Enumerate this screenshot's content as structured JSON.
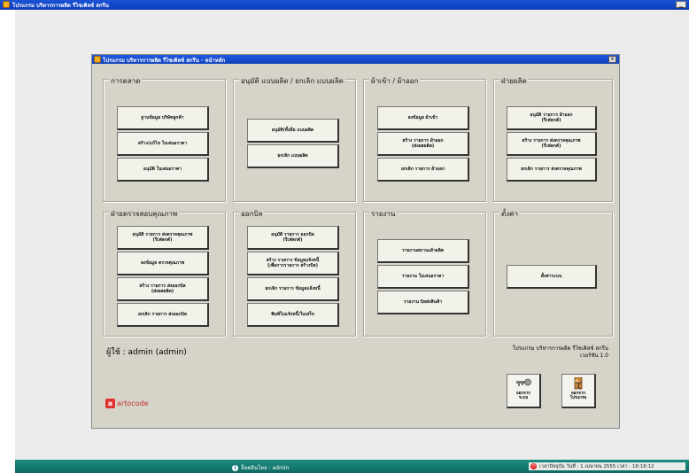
{
  "outer_window": {
    "title": "โปรแกรม บริหารการผลิต รีไซเคิลซ์ สกรีน",
    "control": "_ □"
  },
  "window": {
    "title": "โปรแกรม บริหารการผลิต รีไซเคิลซ์ สกรีน - หน้าหลัก",
    "close": "x"
  },
  "groups": {
    "marketing": {
      "title": "การตลาด",
      "buttons": [
        "ฐานข้อมูล บริษัทลูกค้า",
        "สร้าง/แก้ไข ใบเสนอราคา",
        "อนุมัติ ใบเสนอราคา"
      ]
    },
    "design": {
      "title": "อนุมัติ แบบผลิต / ยกเลิก แบบผลิต",
      "buttons": [
        "อนุมัติ/ทั้งมือ แบบผลิต",
        "ยกเลิก แบบผลิต"
      ]
    },
    "fabric": {
      "title": "ผ้าเข้า / ผ้าออก",
      "buttons": [
        "ลงข้อมูล ผ้าเข้า",
        "สร้าง รายการ ผ้าออก\n(ส่งผลผลิต)",
        "ยกเลิก รายการ ผ้าออก"
      ]
    },
    "production": {
      "title": "ฝ่ายผลิต",
      "buttons": [
        "อนุมัติ รายการ ผ้าออก\n(รีเฟลกต์)",
        "สร้าง รายการ ส่งตรวจคุณภาพ\n(รีเฟลกต์)",
        "ยกเลิก รายการ ส่งตรวจคุณภาพ"
      ]
    },
    "qc": {
      "title": "ฝ่ายตรวจสอบคุณภาพ",
      "buttons": [
        "อนุมัติ รายการ ส่งตรวจคุณภาพ\n(รีเฟลกต์)",
        "ลงข้อมูล ตรวจคุณภาพ",
        "สร้าง รายการ ส่งออกบิล\n(ส่งผลผลิต)",
        "ยกเลิก รายการ ส่งออกบิล"
      ]
    },
    "billing": {
      "title": "ออกบิล",
      "buttons": [
        "อนุมัติ รายการ ออกบิล\n(รีเฟลกต์)",
        "สร้าง รายการ ข้อมูลแจ้งหนี้\n(เพื่อการรายการ สร้างบิล)",
        "ยกเลิก รายการ ข้อมูลแจ้งหนี้",
        "พิมพ์ใบแจ้งหนี้/ใบเสร็จ"
      ]
    },
    "report": {
      "title": "รายงาน",
      "buttons": [
        "รายงานสถานะผ้าผลิต",
        "รายงาน ใบเสนอราคา",
        "รายงาน บิลส่งสินค้า"
      ]
    },
    "settings": {
      "title": "ตั้งค่า",
      "buttons": [
        "ตั้งค่าระบบ"
      ]
    }
  },
  "user_label": "ผู้ใช้ : admin  (admin)",
  "version_text": "โปรแกรม บริหารการผลิต รีไซเคิลซ์ สกรีน\nเวอร์ชัน 1.0",
  "actions": {
    "logout": "ออกจาก\nระบบ",
    "exit": "ออกจาก\nโปรแกรม"
  },
  "logo_text": "artocode",
  "taskbar": {
    "status": "ล็อคอินโดย : admin",
    "datetime": "เวลาปัจจุบัน   วันที่ : 1 เมษายน 2555   เวลา : 16:16:12"
  },
  "icons": {
    "app": "app-icon",
    "logout": "key-icon",
    "exit": "exit-icon",
    "logo": "artocode-logo-icon"
  }
}
